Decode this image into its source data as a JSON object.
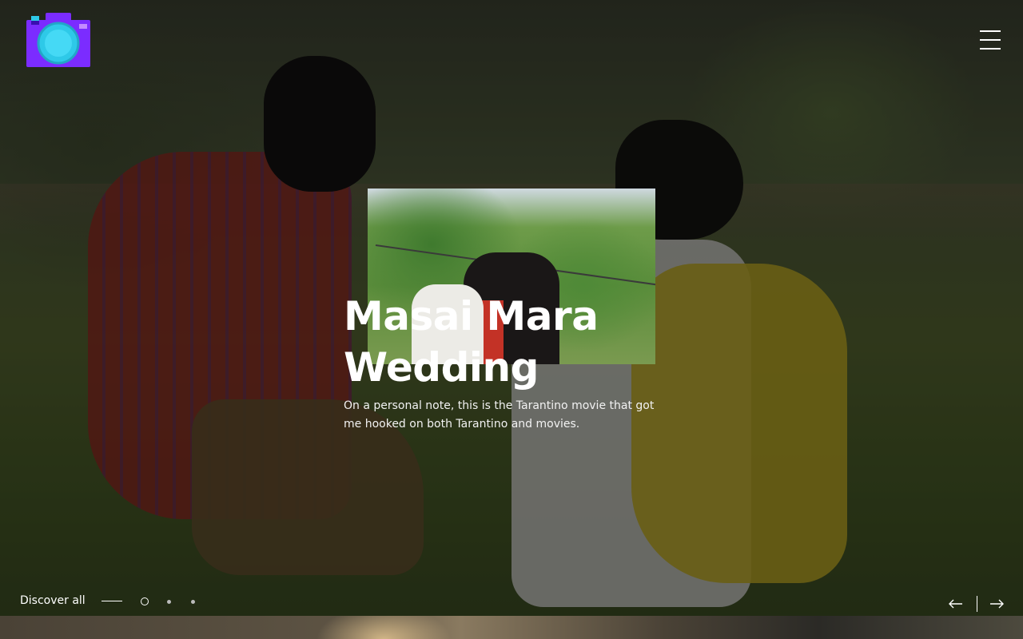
{
  "brand": {
    "logo_icon": "camera-logo-icon"
  },
  "header": {
    "menu_icon": "hamburger-menu-icon"
  },
  "slide": {
    "title_line1": "Masai Mara",
    "title_line2": "Wedding",
    "description": "On a personal note, this is the Tarantino movie that got me hooked on both Tarantino and movies."
  },
  "footer": {
    "discover_label": "Discover all",
    "slides_total": 3,
    "active_slide": 1,
    "prev_icon": "arrow-left-icon",
    "next_icon": "arrow-right-icon"
  },
  "colors": {
    "logo_purple": "#7b2cff",
    "logo_cyan": "#2ec9e8",
    "text": "#ffffff"
  }
}
